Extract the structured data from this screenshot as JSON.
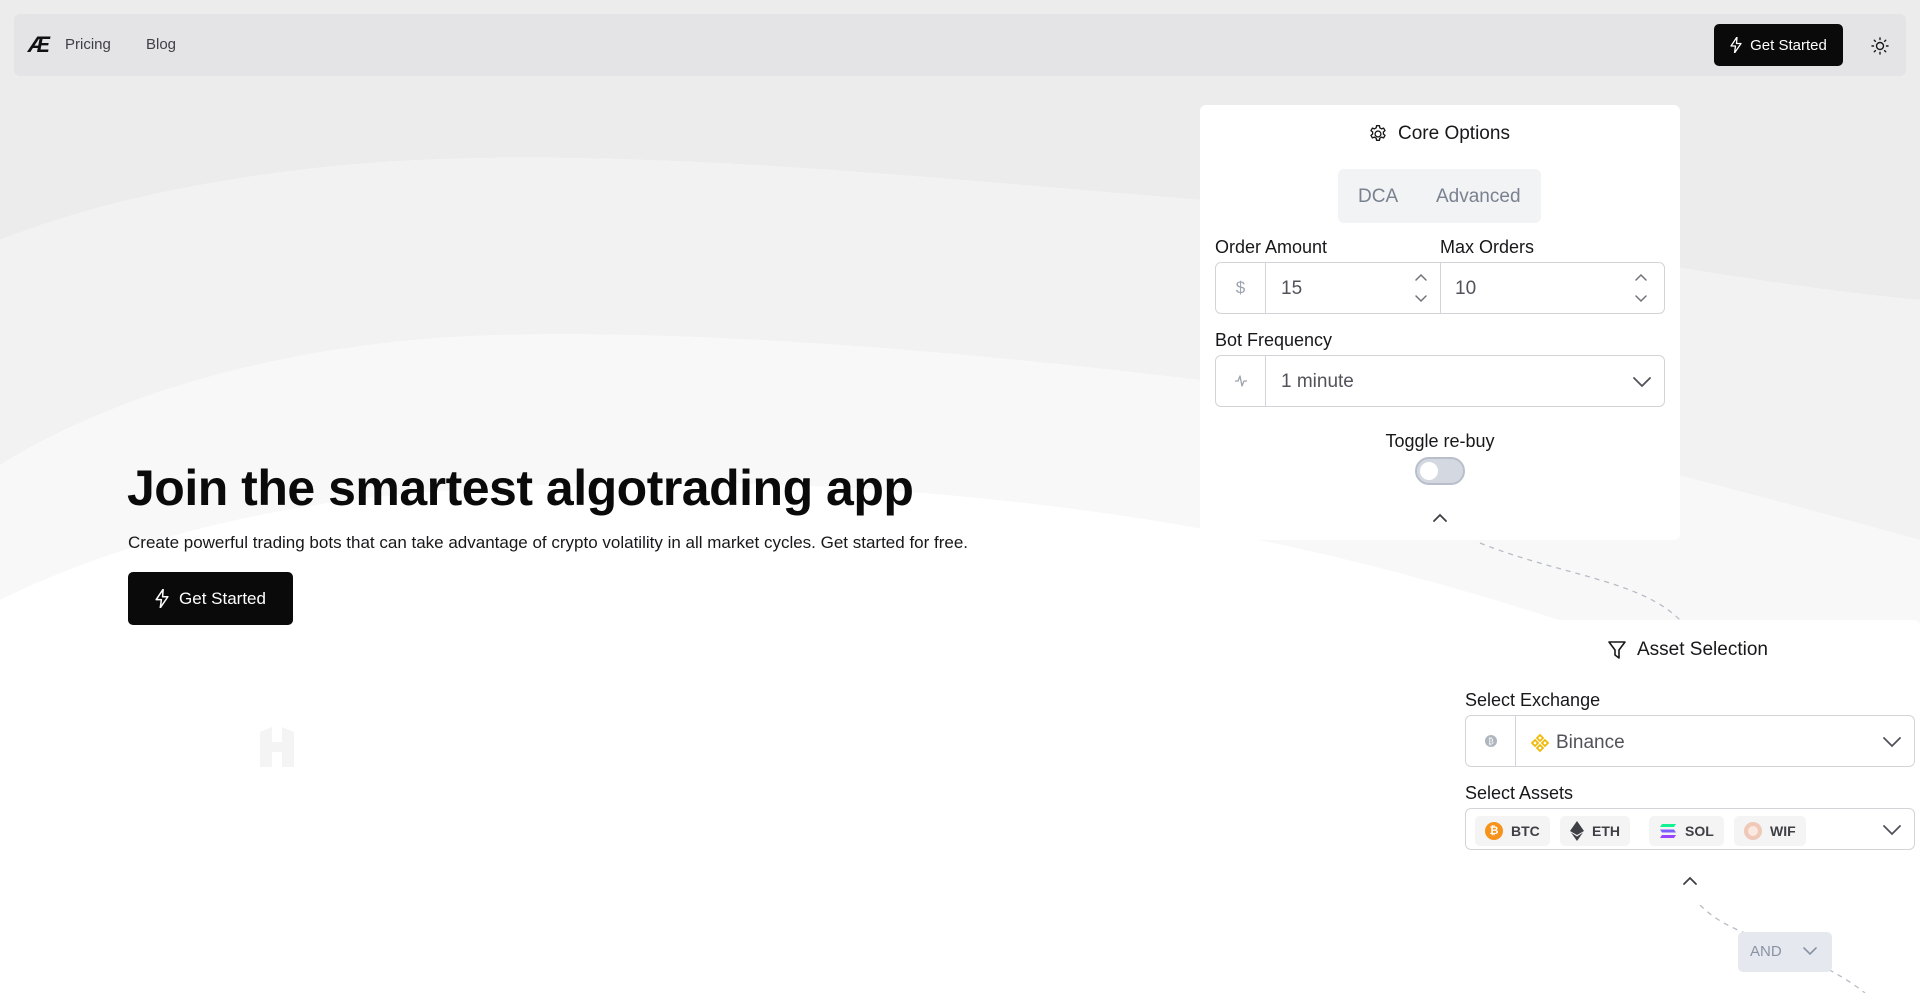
{
  "nav": {
    "logo": "Æ",
    "links": [
      "Pricing",
      "Blog"
    ],
    "cta_label": "Get Started",
    "theme_icon": "sun-icon"
  },
  "hero": {
    "title": "Join the smartest algotrading app",
    "subtitle": "Create powerful trading bots that can take advantage of crypto volatility in all market cycles. Get started for free.",
    "cta_label": "Get Started"
  },
  "core_options": {
    "title": "Core Options",
    "tabs": [
      "DCA",
      "Advanced"
    ],
    "order_amount": {
      "label": "Order Amount",
      "prefix": "$",
      "value": "15"
    },
    "max_orders": {
      "label": "Max Orders",
      "value": "10"
    },
    "bot_frequency": {
      "label": "Bot Frequency",
      "value": "1 minute"
    },
    "toggle_rebuy": {
      "label": "Toggle re-buy",
      "on": false
    }
  },
  "asset_selection": {
    "title": "Asset Selection",
    "exchange": {
      "label": "Select Exchange",
      "value": "Binance"
    },
    "assets": {
      "label": "Select Assets",
      "items": [
        "BTC",
        "ETH",
        "SOL",
        "WIF"
      ]
    }
  },
  "logic_operator": {
    "value": "AND"
  },
  "colors": {
    "primary": "#0a0a0a",
    "btc": "#f7931a",
    "binance": "#f0b90b",
    "nav_bg": "#e4e4e7"
  }
}
